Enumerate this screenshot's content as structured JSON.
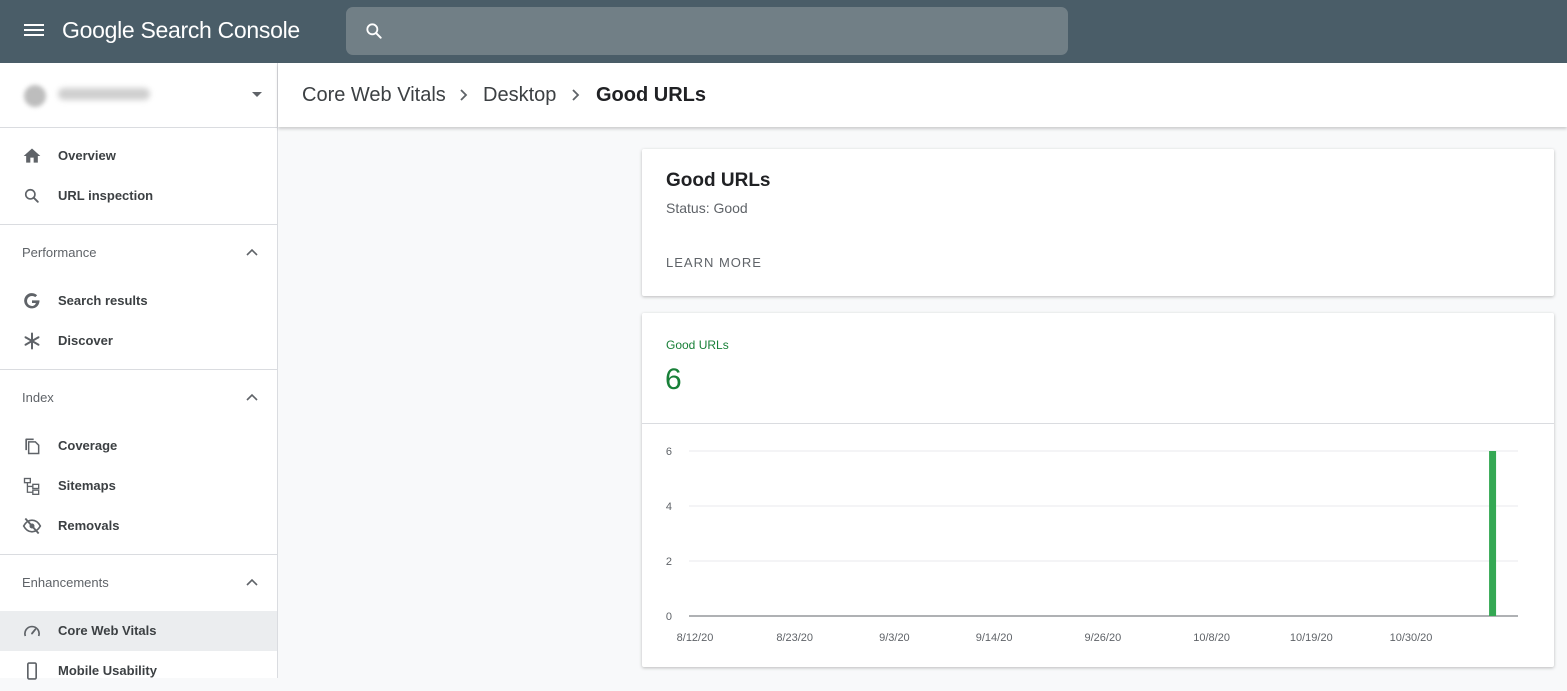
{
  "app": {
    "title": "Google Search Console",
    "menu_icon": "menu-icon",
    "search_icon": "search-icon"
  },
  "search": {
    "placeholder": ""
  },
  "property": {
    "name": "",
    "caret_icon": "arrow-drop-down-icon"
  },
  "sidebar": {
    "top_items": [
      {
        "label": "Overview",
        "icon": "home-icon"
      },
      {
        "label": "URL inspection",
        "icon": "search-icon"
      }
    ],
    "groups": [
      {
        "title": "Performance",
        "items": [
          {
            "label": "Search results",
            "icon": "google-g-icon"
          },
          {
            "label": "Discover",
            "icon": "asterisk-icon"
          }
        ]
      },
      {
        "title": "Index",
        "items": [
          {
            "label": "Coverage",
            "icon": "copy-pages-icon"
          },
          {
            "label": "Sitemaps",
            "icon": "sitemap-icon"
          },
          {
            "label": "Removals",
            "icon": "visibility-off-icon"
          }
        ]
      },
      {
        "title": "Enhancements",
        "items": [
          {
            "label": "Core Web Vitals",
            "icon": "speedometer-icon",
            "active": true
          },
          {
            "label": "Mobile Usability",
            "icon": "smartphone-icon"
          }
        ]
      }
    ]
  },
  "breadcrumb": [
    "Core Web Vitals",
    "Desktop",
    "Good URLs"
  ],
  "info_card": {
    "title": "Good URLs",
    "status": "Status: Good",
    "learn_more": "LEARN MORE"
  },
  "metric": {
    "label": "Good URLs",
    "value": "6",
    "color": "#188038"
  },
  "colors": {
    "topbar": "#4a5d68",
    "accent_green": "#188038",
    "bar_green": "#34a853"
  },
  "chart_data": {
    "type": "bar",
    "x_ticks": [
      "8/12/20",
      "8/23/20",
      "9/3/20",
      "9/14/20",
      "9/26/20",
      "10/8/20",
      "10/19/20",
      "10/30/20"
    ],
    "y_ticks": [
      "0",
      "2",
      "4",
      "6"
    ],
    "ylim": [
      0,
      6
    ],
    "series": [
      {
        "values": [
          {
            "x": "11/8/20",
            "y": 6
          }
        ]
      }
    ],
    "grid": true
  }
}
